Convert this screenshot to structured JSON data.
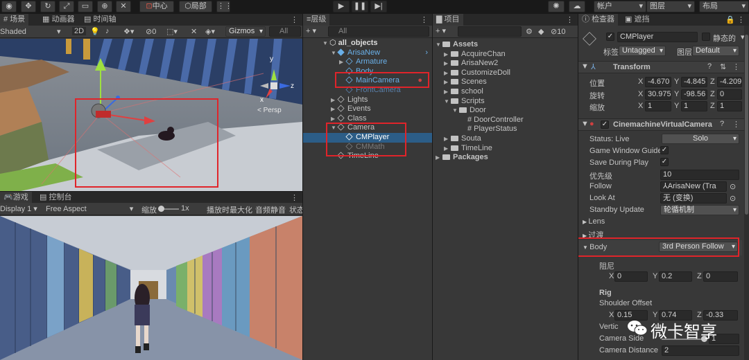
{
  "toolbar": {
    "center": "中心",
    "local": "局部",
    "account": "帐户",
    "layers": "图层",
    "layout": "布局"
  },
  "scene": {
    "tab1": "场景",
    "tab2": "动画器",
    "tab3": "时间轴",
    "shading": "Shaded",
    "mode2d": "2D",
    "vis_count": "0",
    "gizmos": "Gizmos",
    "search": "All",
    "persp": "< Persp"
  },
  "game": {
    "tab1": "游戏",
    "tab2": "控制台",
    "display": "Display 1",
    "aspect": "Free Aspect",
    "scale_label": "缩放",
    "scale_val": "1x",
    "maximize": "播放时最大化",
    "mute": "音频静音",
    "stats": "状态"
  },
  "hierarchy": {
    "tab": "层级",
    "search": "All",
    "items": [
      "all_objects",
      "ArisaNew",
      "Armature",
      "Body",
      "MainCamera",
      "FrontCamera",
      "Lights",
      "Events",
      "Class",
      "Camera",
      "CMPlayer",
      "CMMath",
      "TimeLine"
    ]
  },
  "project": {
    "tab": "项目",
    "count": "10",
    "items": [
      "Assets",
      "AcquireChan",
      "ArisaNew2",
      "CustomizeDoll",
      "Scenes",
      "school",
      "Scripts",
      "Door",
      "DoorController",
      "PlayerStatus",
      "Souta",
      "TimeLine",
      "Packages"
    ]
  },
  "inspector": {
    "tab1": "检查器",
    "tab2": "遮挡",
    "name": "CMPlayer",
    "static": "静态的",
    "tag_label": "标签",
    "tag": "Untagged",
    "layer_label": "图层",
    "layer": "Default",
    "transform": {
      "title": "Transform",
      "pos_label": "位置",
      "rot_label": "旋转",
      "scale_label": "缩放",
      "pos": [
        "-4.670",
        "-4.845",
        "-4.209"
      ],
      "rot": [
        "30.975",
        "-98.56",
        "0"
      ],
      "scale": [
        "1",
        "1",
        "1"
      ]
    },
    "vcam": {
      "title": "CinemachineVirtualCamera",
      "status": "Status: Live",
      "solo": "Solo",
      "gwg": "Game Window Guide",
      "sdp": "Save During Play",
      "priority_label": "优先级",
      "priority": "10",
      "follow_label": "Follow",
      "follow": "ArisaNew (Tra",
      "lookat_label": "Look At",
      "lookat": "无 (变换)",
      "standby_label": "Standby Update",
      "standby": "轮循机制",
      "lens": "Lens",
      "transition": "过渡",
      "body_label": "Body",
      "body": "3rd Person Follow",
      "damping_label": "阻尼",
      "damping": [
        "0",
        "0.2",
        "0"
      ],
      "rig": "Rig",
      "shoulder_label": "Shoulder Offset",
      "shoulder": [
        "0.15",
        "0.74",
        "-0.33"
      ],
      "vertical": "Vertic",
      "camera_side_label": "Camera Side",
      "camera_side": "1",
      "camera_distance_label": "Camera Distance",
      "camera_distance": "2"
    }
  },
  "watermark": "微卡智享",
  "axis": {
    "x": "x",
    "y": "y",
    "z": "z"
  }
}
